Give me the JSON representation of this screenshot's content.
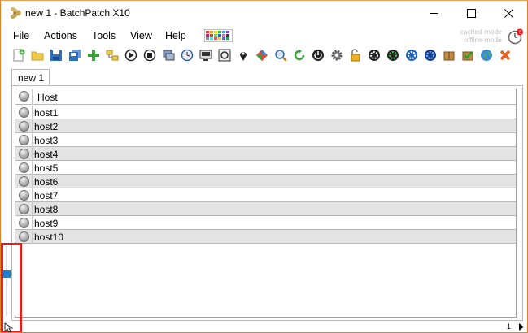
{
  "window": {
    "title": "new 1 - BatchPatch X10"
  },
  "menu": [
    "File",
    "Actions",
    "Tools",
    "View",
    "Help"
  ],
  "modes": {
    "line1": "cached-mode",
    "line2": "offline-mode"
  },
  "toolbar_icons": [
    "new-grid-icon",
    "open-folder-icon",
    "save-icon",
    "save-all-icon",
    "add-hosts-icon",
    "host-groups-icon",
    "play-icon",
    "stop-icon",
    "remote-agent-icon",
    "scheduler-icon",
    "deploy-icon",
    "queue-icon",
    "location-pin-icon",
    "diamond-icon",
    "search-icon",
    "refresh-icon",
    "power-icon",
    "gear-icon",
    "unlock-icon",
    "cycle-1-icon",
    "cycle-2-icon",
    "cycle-3-icon",
    "cycle-4-icon",
    "package-icon",
    "approve-icon",
    "globe-icon",
    "close-x-icon"
  ],
  "tabs": [
    {
      "label": "new 1"
    }
  ],
  "grid": {
    "header": "Host",
    "rows": [
      "host1",
      "host2",
      "host3",
      "host4",
      "host5",
      "host6",
      "host7",
      "host8",
      "host9",
      "host10"
    ]
  },
  "status": {
    "page": "1"
  },
  "colors": {
    "alt_row": "#e3e3e3",
    "highlight": "#e02020",
    "scroll_thumb": "#1e7fd0"
  }
}
